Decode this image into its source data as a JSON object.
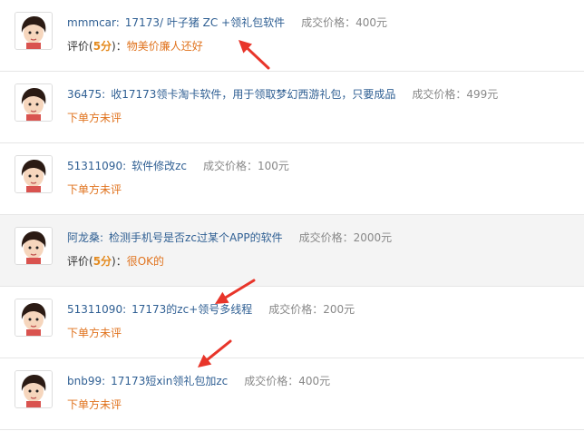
{
  "colors": {
    "link": "#2f5f93",
    "price": "#888888",
    "accent": "#e0731e",
    "arrow": "#e8352a"
  },
  "rows": [
    {
      "user": "mmmcar:",
      "title": "17173/ 叶子猪 ZC +领礼包软件",
      "price": "成交价格：400元",
      "rated": true,
      "rating_prefix": "评价(",
      "score": "5分",
      "rating_suffix": ")：",
      "comment": "物美价廉人还好",
      "avatar_icon": "cartoon-girl-avatar-icon",
      "shaded": false
    },
    {
      "user": "36475:",
      "title": "收17173领卡淘卡软件，用于领取梦幻西游礼包，只要成品",
      "price": "成交价格：499元",
      "rated": false,
      "comment": "下单方未评",
      "avatar_icon": "cartoon-girl-avatar-icon",
      "shaded": false
    },
    {
      "user": "51311090:",
      "title": "软件修改zc",
      "price": "成交价格：100元",
      "rated": false,
      "comment": "下单方未评",
      "avatar_icon": "cartoon-girl-avatar-icon",
      "shaded": false
    },
    {
      "user": "阿龙桑:",
      "title": "检测手机号是否zc过某个APP的软件",
      "price": "成交价格：2000元",
      "rated": true,
      "rating_prefix": "评价(",
      "score": "5分",
      "rating_suffix": ")：",
      "comment": "很OK的",
      "avatar_icon": "cartoon-girl-avatar-icon",
      "shaded": true
    },
    {
      "user": "51311090:",
      "title": "17173的zc+领号多线程",
      "price": "成交价格：200元",
      "rated": false,
      "comment": "下单方未评",
      "avatar_icon": "cartoon-girl-avatar-icon",
      "shaded": false
    },
    {
      "user": "bnb99:",
      "title": "17173短xin领礼包加zc",
      "price": "成交价格：400元",
      "rated": false,
      "comment": "下单方未评",
      "avatar_icon": "cartoon-girl-avatar-icon",
      "shaded": false
    }
  ],
  "annotations": [
    {
      "name": "red-arrow-icon"
    },
    {
      "name": "red-arrow-icon"
    },
    {
      "name": "red-arrow-icon"
    }
  ]
}
